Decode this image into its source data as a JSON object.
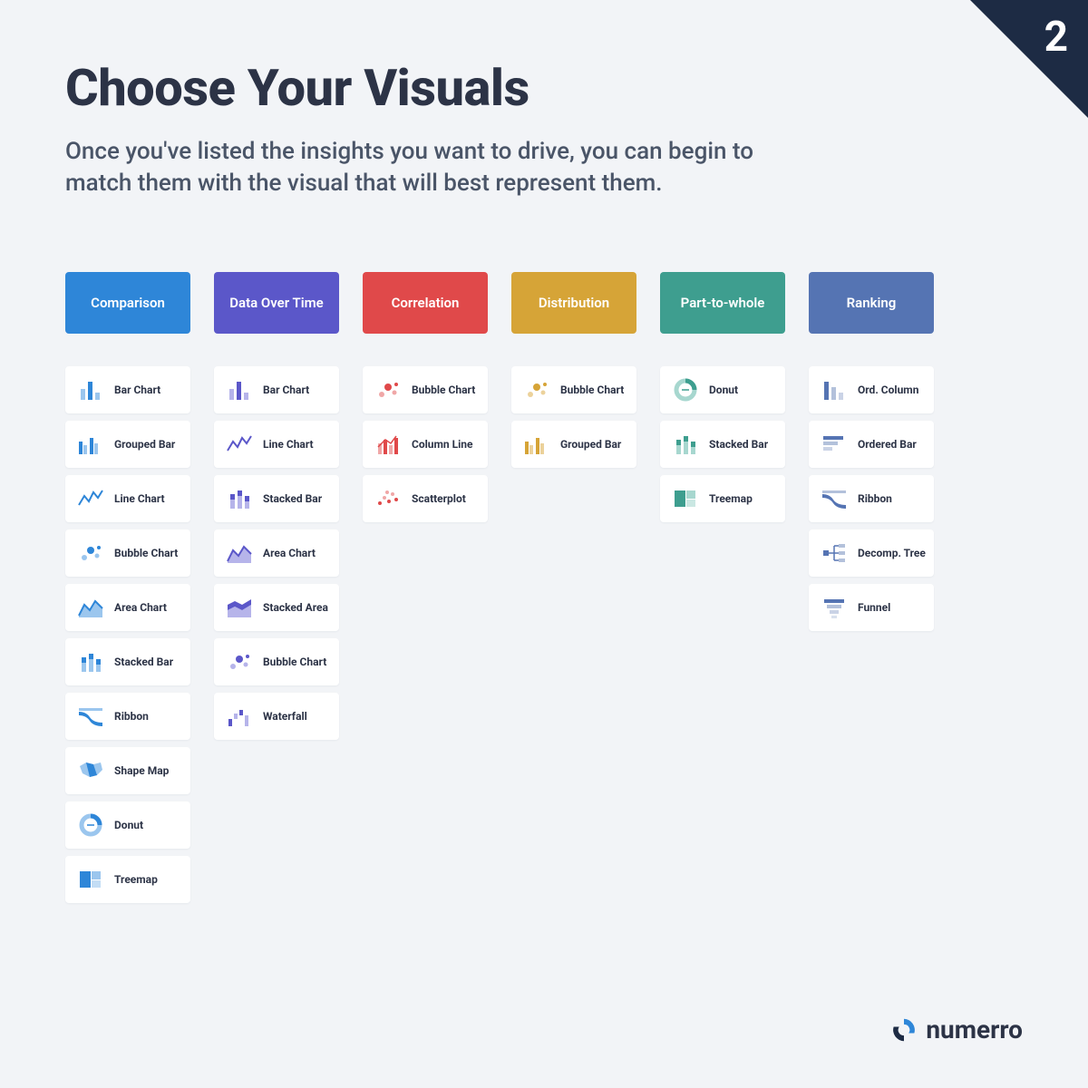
{
  "corner_number": "2",
  "title": "Choose Your Visuals",
  "subtitle": "Once you've listed the insights you want to drive, you can begin to match them with the visual that will best represent them.",
  "columns": [
    {
      "name": "Comparison",
      "color": "#2e86d8",
      "items": [
        {
          "label": "Bar Chart",
          "icon": "bar-blue"
        },
        {
          "label": "Grouped Bar",
          "icon": "grouped-bar-blue"
        },
        {
          "label": "Line Chart",
          "icon": "line-blue"
        },
        {
          "label": "Bubble Chart",
          "icon": "bubble-blue"
        },
        {
          "label": "Area Chart",
          "icon": "area-blue"
        },
        {
          "label": "Stacked Bar",
          "icon": "stacked-bar-blue"
        },
        {
          "label": "Ribbon",
          "icon": "ribbon-blue"
        },
        {
          "label": "Shape Map",
          "icon": "shape-map-blue"
        },
        {
          "label": "Donut",
          "icon": "donut-blue"
        },
        {
          "label": "Treemap",
          "icon": "treemap-blue"
        }
      ]
    },
    {
      "name": "Data Over Time",
      "color": "#5b57c9",
      "items": [
        {
          "label": "Bar Chart",
          "icon": "bar-purple"
        },
        {
          "label": "Line Chart",
          "icon": "line-purple"
        },
        {
          "label": "Stacked Bar",
          "icon": "stacked-bar-purple"
        },
        {
          "label": "Area Chart",
          "icon": "area-purple"
        },
        {
          "label": "Stacked Area",
          "icon": "stacked-area-purple"
        },
        {
          "label": "Bubble Chart",
          "icon": "bubble-purple"
        },
        {
          "label": "Waterfall",
          "icon": "waterfall-purple"
        }
      ]
    },
    {
      "name": "Correlation",
      "color": "#e0494a",
      "items": [
        {
          "label": "Bubble Chart",
          "icon": "bubble-red"
        },
        {
          "label": "Column Line",
          "icon": "column-line-red"
        },
        {
          "label": "Scatterplot",
          "icon": "scatter-red"
        }
      ]
    },
    {
      "name": "Distribution",
      "color": "#d6a437",
      "items": [
        {
          "label": "Bubble Chart",
          "icon": "bubble-yellow"
        },
        {
          "label": "Grouped Bar",
          "icon": "grouped-bar-yellow"
        }
      ]
    },
    {
      "name": "Part-to-whole",
      "color": "#3e9e8f",
      "items": [
        {
          "label": "Donut",
          "icon": "donut-teal"
        },
        {
          "label": "Stacked Bar",
          "icon": "stacked-bar-teal"
        },
        {
          "label": "Treemap",
          "icon": "treemap-teal"
        }
      ]
    },
    {
      "name": "Ranking",
      "color": "#5574b3",
      "items": [
        {
          "label": "Ord. Column",
          "icon": "ord-column-slate"
        },
        {
          "label": "Ordered Bar",
          "icon": "ordered-bar-slate"
        },
        {
          "label": "Ribbon",
          "icon": "ribbon-slate"
        },
        {
          "label": "Decomp. Tree",
          "icon": "decomp-tree-slate"
        },
        {
          "label": "Funnel",
          "icon": "funnel-slate"
        }
      ]
    }
  ],
  "palette": {
    "blue": {
      "p": "#2e86d8",
      "s": "#9bc6ee"
    },
    "purple": {
      "p": "#5b57c9",
      "s": "#b6b4ea"
    },
    "red": {
      "p": "#e0494a",
      "s": "#f0a7a7"
    },
    "yellow": {
      "p": "#d6a437",
      "s": "#ecd29b"
    },
    "teal": {
      "p": "#3e9e8f",
      "s": "#a7d7cf"
    },
    "slate": {
      "p": "#5574b3",
      "s": "#b3c1db"
    }
  },
  "brand": "numerro"
}
